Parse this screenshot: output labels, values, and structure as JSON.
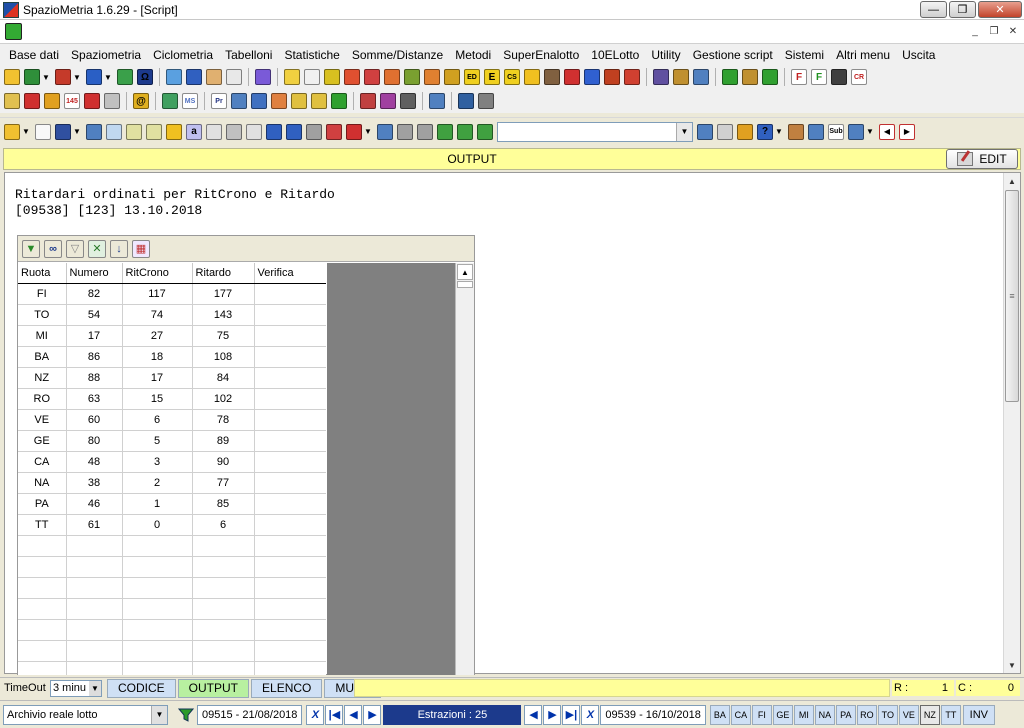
{
  "window": {
    "title": "SpazioMetria  1.6.29 - [Script]",
    "minimize_label": "—",
    "maximize_label": "❐",
    "close_label": "✕"
  },
  "mdi": {
    "minimize_label": "_",
    "restore_label": "❐",
    "close_label": "✕"
  },
  "menu": [
    "Base dati",
    "Spaziometria",
    "Ciclometria",
    "Tabelloni",
    "Statistiche",
    "Somme/Distanze",
    "Metodi",
    "SuperEnalotto",
    "10ELotto",
    "Utility",
    "Gestione script",
    "Sistemi",
    "Altri menu",
    "Uscita"
  ],
  "toolbar1_icons": [
    {
      "name": "open-folder-icon",
      "color": "#f2c230",
      "dd": false
    },
    {
      "name": "globe-icon",
      "color": "#2f8f3a",
      "dd": true
    },
    {
      "name": "globe-red-icon",
      "color": "#c53a2a",
      "dd": true
    },
    {
      "name": "globe-blue-icon",
      "color": "#2a5fc5",
      "dd": true
    },
    {
      "name": "globe-green-icon",
      "color": "#3aa04a",
      "dd": false
    },
    {
      "name": "omega-icon",
      "color": "#1c3a8c",
      "glyph": "Ω",
      "dd": false
    },
    {
      "sep": true
    },
    {
      "name": "table-icon",
      "color": "#5aa0e0"
    },
    {
      "name": "chart-line-icon",
      "color": "#3060c0"
    },
    {
      "name": "hand-icon",
      "color": "#e0b070"
    },
    {
      "name": "document-icon",
      "color": "#e8e8e8"
    },
    {
      "sep": true
    },
    {
      "name": "circle-triangle-icon",
      "color": "#7a5ad8"
    },
    {
      "sep": true
    },
    {
      "name": "chart-icon",
      "color": "#f0d040"
    },
    {
      "name": "doc-edit-icon",
      "color": "#f0f0f0"
    },
    {
      "name": "grid-yellow-icon",
      "color": "#d8c020"
    },
    {
      "name": "tables-icon",
      "color": "#e05030"
    },
    {
      "name": "grid-red-icon",
      "color": "#d04040"
    },
    {
      "name": "frame-icon",
      "color": "#e07030"
    },
    {
      "name": "grid-green-icon",
      "color": "#7aa030"
    },
    {
      "name": "grid-orange-icon",
      "color": "#e08030"
    },
    {
      "name": "grid-gold-icon",
      "color": "#d0a020"
    },
    {
      "name": "ed-icon",
      "color": "#f0d020",
      "glyph": "ED"
    },
    {
      "name": "e-icon",
      "color": "#f0d020",
      "glyph": "E"
    },
    {
      "name": "cs-icon",
      "color": "#f0d020",
      "glyph": "CS"
    },
    {
      "name": "lightning-icon",
      "color": "#f0c020"
    },
    {
      "name": "chess-icon",
      "color": "#806040"
    },
    {
      "name": "triangle-red-icon",
      "color": "#d03030"
    },
    {
      "name": "list-icon",
      "color": "#3060d0"
    },
    {
      "name": "grid-multi-icon",
      "color": "#c04020"
    },
    {
      "name": "wheel-icon",
      "color": "#d04030"
    },
    {
      "sep": true
    },
    {
      "name": "bar-chart-icon",
      "color": "#6050a0"
    },
    {
      "name": "scales-icon",
      "color": "#c09030"
    },
    {
      "name": "line-graph-icon",
      "color": "#5080c0"
    },
    {
      "sep": true
    },
    {
      "name": "green-circle-icon",
      "color": "#30a030"
    },
    {
      "name": "balance-icon",
      "color": "#c09030"
    },
    {
      "name": "filter-icon",
      "color": "#30a030"
    },
    {
      "sep": true
    },
    {
      "name": "f-red-icon",
      "color": "#ffffff",
      "glyph": "F",
      "fg": "#c02020"
    },
    {
      "name": "f-green-icon",
      "color": "#ffffff",
      "glyph": "F",
      "fg": "#209020"
    },
    {
      "name": "spy-icon",
      "color": "#404040"
    },
    {
      "name": "cr-icon",
      "color": "#ffffff",
      "glyph": "CR",
      "fg": "#c02020"
    }
  ],
  "toolbar2_icons": [
    {
      "name": "grid-small-icon",
      "color": "#e0c050"
    },
    {
      "name": "flag-icon",
      "color": "#d03030"
    },
    {
      "name": "star-icon",
      "color": "#e0a020"
    },
    {
      "name": "numbers-icon",
      "color": "#ffffff",
      "glyph": "145",
      "fg": "#c02020"
    },
    {
      "name": "arrows-vertical-icon",
      "color": "#d03030"
    },
    {
      "name": "tools-icon",
      "color": "#c0c0c0"
    },
    {
      "sep": true
    },
    {
      "name": "at-icon",
      "color": "#e0b020",
      "glyph": "@"
    },
    {
      "sep": true
    },
    {
      "name": "abc-icon",
      "color": "#40a060"
    },
    {
      "name": "ms-icon",
      "color": "#ffffff",
      "glyph": "MS",
      "fg": "#5070c0"
    },
    {
      "sep": true
    },
    {
      "name": "pr-icon",
      "color": "#ffffff",
      "glyph": "Pr",
      "fg": "#203080"
    },
    {
      "name": "keyboard-icon",
      "color": "#5080c0"
    },
    {
      "name": "list-blue-icon",
      "color": "#4070c0"
    },
    {
      "name": "bar-icon",
      "color": "#e08040"
    },
    {
      "name": "pencil-icon",
      "color": "#e0c040"
    },
    {
      "name": "grid-x-icon",
      "color": "#e0c040"
    },
    {
      "name": "network-icon",
      "color": "#30a030"
    },
    {
      "sep": true
    },
    {
      "name": "puzzle-icon",
      "color": "#c04040"
    },
    {
      "name": "puzzle2-icon",
      "color": "#a040a0"
    },
    {
      "name": "chess2-icon",
      "color": "#606060"
    },
    {
      "sep": true
    },
    {
      "name": "calc-icon",
      "color": "#5080c0"
    },
    {
      "sep": true
    },
    {
      "name": "device-icon",
      "color": "#3060a0"
    },
    {
      "name": "hammer-icon",
      "color": "#808080"
    }
  ],
  "toolbar3_icons": [
    {
      "name": "open-script-icon",
      "color": "#f0c030",
      "dd": true
    },
    {
      "name": "new-doc-icon",
      "color": "#f8f8f8"
    },
    {
      "name": "save-icon",
      "color": "#3050a0",
      "dd": true
    },
    {
      "name": "output-toggle-icon",
      "color": "#5080c0"
    },
    {
      "name": "window-icon",
      "color": "#c0d8f0"
    },
    {
      "name": "edit-doc-icon",
      "color": "#e0e0a0"
    },
    {
      "name": "edit-doc2-icon",
      "color": "#e0e0a0"
    },
    {
      "name": "run-icon",
      "color": "#f0c020"
    },
    {
      "name": "find-icon",
      "color": "#c0c0f0",
      "glyph": "a"
    },
    {
      "name": "copy-icon",
      "color": "#e0e0e0"
    },
    {
      "name": "cut-icon",
      "color": "#c0c0c0"
    },
    {
      "name": "paste-icon",
      "color": "#e0e0e0"
    },
    {
      "name": "undo-icon",
      "color": "#3060c0"
    },
    {
      "name": "redo-icon",
      "color": "#3060c0"
    },
    {
      "name": "print-icon",
      "color": "#a0a0a0"
    },
    {
      "name": "doc-red-icon",
      "color": "#d04040"
    },
    {
      "name": "stop-icon",
      "color": "#d03030",
      "dd": true
    },
    {
      "name": "magnify-icon",
      "color": "#5080c0"
    },
    {
      "name": "align-icon",
      "color": "#a0a0a0"
    },
    {
      "name": "indent-icon",
      "color": "#a0a0a0"
    },
    {
      "name": "format-icon",
      "color": "#40a040"
    },
    {
      "name": "outdent-icon",
      "color": "#40a040"
    },
    {
      "name": "list-indent-icon",
      "color": "#40a040"
    }
  ],
  "toolbar3_right_icons": [
    {
      "name": "pencil-edit-icon",
      "color": "#5080c0"
    },
    {
      "name": "doc-lines-icon",
      "color": "#d0d0d0"
    },
    {
      "name": "star-tool-icon",
      "color": "#e0a020"
    },
    {
      "name": "help-icon",
      "color": "#3060c0",
      "glyph": "?",
      "dd": true
    },
    {
      "name": "tool-icon",
      "color": "#c08040"
    },
    {
      "name": "resize-icon",
      "color": "#5080c0"
    },
    {
      "name": "sub-end-icon",
      "color": "#ffffff",
      "glyph": "Sub",
      "fg": "#000"
    },
    {
      "name": "window-dd-icon",
      "color": "#5080c0",
      "dd": true
    }
  ],
  "output": {
    "header_title": "OUTPUT",
    "edit_label": "EDIT",
    "text_line1": "Ritardari ordinati per RitCrono e Ritardo",
    "text_line2": "[09538] [123] 13.10.2018"
  },
  "grid": {
    "columns": [
      "Ruota",
      "Numero",
      "RitCrono",
      "Ritardo",
      "Verifica"
    ],
    "rows": [
      [
        "FI",
        "82",
        "117",
        "177",
        ""
      ],
      [
        "TO",
        "54",
        "74",
        "143",
        ""
      ],
      [
        "MI",
        "17",
        "27",
        "75",
        ""
      ],
      [
        "BA",
        "86",
        "18",
        "108",
        ""
      ],
      [
        "NZ",
        "88",
        "17",
        "84",
        ""
      ],
      [
        "RO",
        "63",
        "15",
        "102",
        ""
      ],
      [
        "VE",
        "60",
        "6",
        "78",
        ""
      ],
      [
        "GE",
        "80",
        "5",
        "89",
        ""
      ],
      [
        "CA",
        "48",
        "3",
        "90",
        ""
      ],
      [
        "NA",
        "38",
        "2",
        "77",
        ""
      ],
      [
        "PA",
        "46",
        "1",
        "85",
        ""
      ],
      [
        "TT",
        "61",
        "0",
        "6",
        ""
      ]
    ],
    "empty_rows": 7
  },
  "statusbar": {
    "timeout_label": "TimeOut",
    "timeout_value": "3 minu",
    "tabs": [
      {
        "label": "CODICE",
        "active": false
      },
      {
        "label": "OUTPUT",
        "active": true
      },
      {
        "label": "ELENCO",
        "active": false
      },
      {
        "label": "MULTI",
        "active": false
      }
    ],
    "r_label": "R :",
    "r_value": "1",
    "c_label": "C :",
    "c_value": "0"
  },
  "navbar": {
    "archive": "Archivio reale lotto",
    "start_date": "09515 - 21/08/2018",
    "estrazioni": "Estrazioni : 25",
    "end_date": "09539 - 16/10/2018",
    "ruote": [
      "BA",
      "CA",
      "FI",
      "GE",
      "MI",
      "NA",
      "PA",
      "RO",
      "TO",
      "VE",
      "NZ",
      "TT"
    ],
    "active_ruota": "NZ",
    "inv_label": "INV"
  }
}
